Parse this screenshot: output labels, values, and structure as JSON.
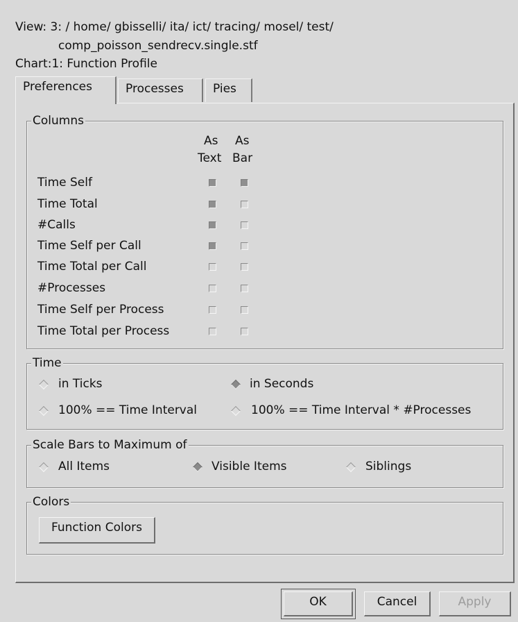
{
  "header": {
    "view_line1": "View: 3: / home/ gbisselli/ ita/ ict/ tracing/ mosel/ test/",
    "view_line2": "comp_poisson_sendrecv.single.stf",
    "chart_line": "Chart:1: Function Profile"
  },
  "tabs": [
    {
      "label": "Preferences",
      "active": true
    },
    {
      "label": "Processes",
      "active": false
    },
    {
      "label": "Pies",
      "active": false
    }
  ],
  "columns": {
    "title": "Columns",
    "head_text_line1": "As",
    "head_text_line2": "Text",
    "head_bar_line1": "As",
    "head_bar_line2": "Bar",
    "rows": [
      {
        "label": "Time Self",
        "as_text": true,
        "as_bar": true
      },
      {
        "label": "Time Total",
        "as_text": true,
        "as_bar": false
      },
      {
        "label": "#Calls",
        "as_text": true,
        "as_bar": false
      },
      {
        "label": "Time Self per Call",
        "as_text": true,
        "as_bar": false
      },
      {
        "label": "Time Total per Call",
        "as_text": false,
        "as_bar": false
      },
      {
        "label": "#Processes",
        "as_text": false,
        "as_bar": false
      },
      {
        "label": "Time Self per Process",
        "as_text": false,
        "as_bar": false
      },
      {
        "label": "Time Total per Process",
        "as_text": false,
        "as_bar": false
      }
    ]
  },
  "time": {
    "title": "Time",
    "options": [
      {
        "label": "in Ticks",
        "selected": false
      },
      {
        "label": "in Seconds",
        "selected": true
      },
      {
        "label": "100% == Time Interval",
        "selected": false
      },
      {
        "label": "100% == Time Interval * #Processes",
        "selected": false
      }
    ]
  },
  "scale": {
    "title": "Scale Bars to Maximum of",
    "options": [
      {
        "label": "All Items",
        "selected": false
      },
      {
        "label": "Visible Items",
        "selected": true
      },
      {
        "label": "Siblings",
        "selected": false
      }
    ]
  },
  "colors": {
    "title": "Colors",
    "button": "Function Colors"
  },
  "buttons": {
    "ok": "OK",
    "cancel": "Cancel",
    "apply": "Apply"
  }
}
